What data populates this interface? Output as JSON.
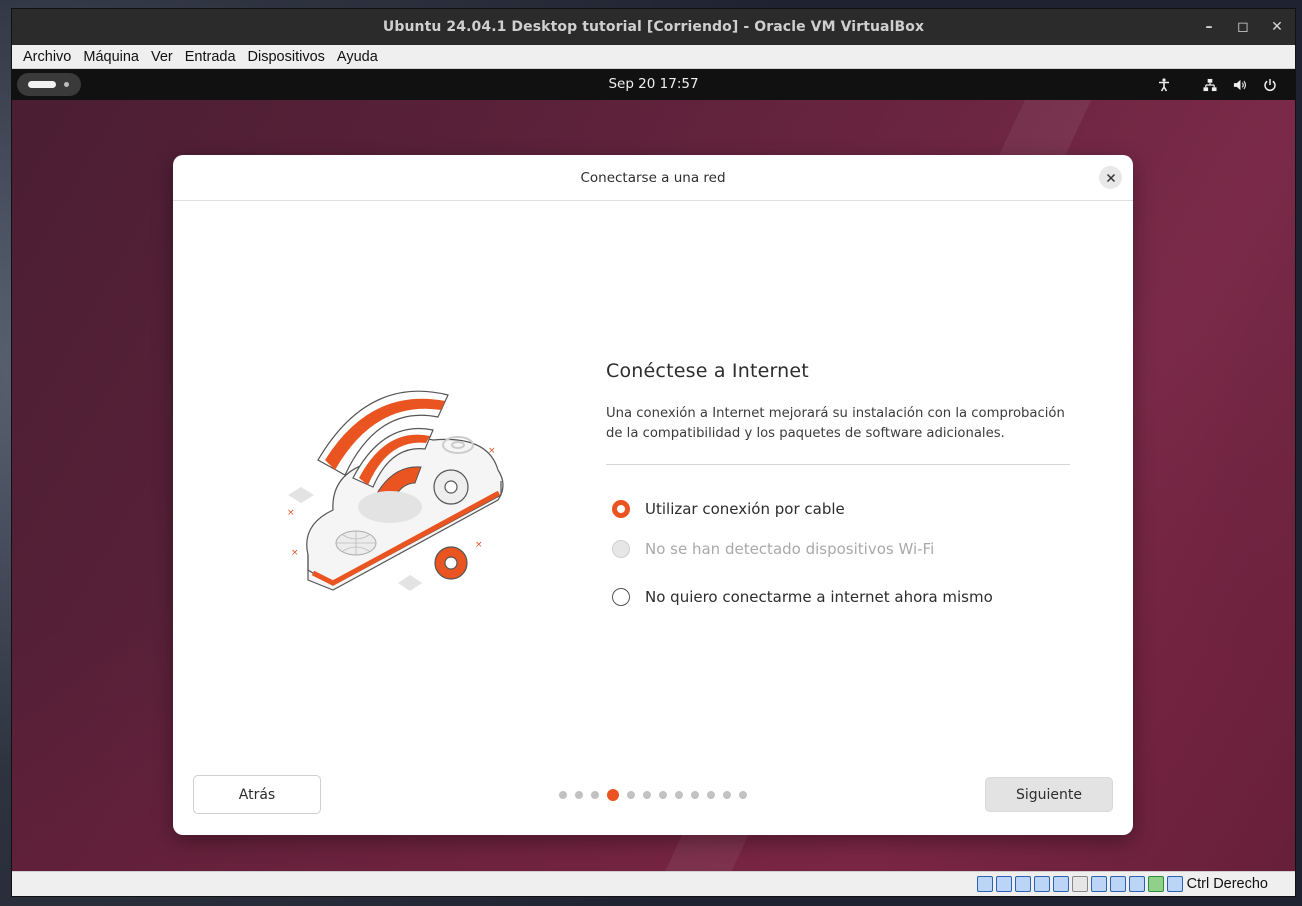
{
  "window": {
    "title": "Ubuntu 24.04.1 Desktop tutorial [Corriendo] - Oracle VM VirtualBox",
    "controls": [
      "minimize-icon",
      "maximize-icon",
      "close-icon"
    ]
  },
  "menubar": {
    "items": [
      "Archivo",
      "Máquina",
      "Ver",
      "Entrada",
      "Dispositivos",
      "Ayuda"
    ]
  },
  "topbar": {
    "clock": "Sep 20  17:57",
    "tray_icons": [
      "accessibility-icon",
      "network-icon",
      "volume-icon",
      "power-icon"
    ]
  },
  "dialog": {
    "title": "Conectarse a una red",
    "heading": "Conéctese a Internet",
    "description": "Una conexión a Internet mejorará su instalación con la comprobación de la compatibilidad y los paquetes de software adicionales.",
    "options": [
      {
        "label": "Utilizar conexión por cable",
        "selected": true,
        "disabled": false
      },
      {
        "label": "No se han detectado dispositivos Wi-Fi",
        "selected": false,
        "disabled": true
      },
      {
        "label": "No quiero conectarme a internet ahora mismo",
        "selected": false,
        "disabled": false
      }
    ],
    "back_label": "Atrás",
    "next_label": "Siguiente",
    "pager": {
      "total_steps": 12,
      "current_step": 4
    },
    "accent_color": "#e95420"
  },
  "statusbar": {
    "host_key": "Ctrl Derecho"
  }
}
